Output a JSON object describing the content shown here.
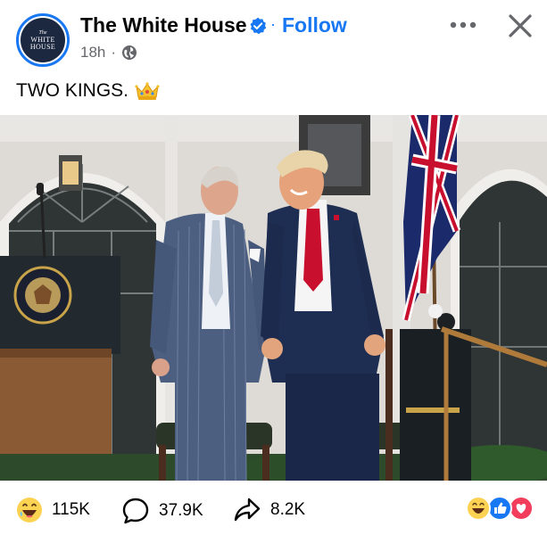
{
  "post": {
    "page_name": "The White House",
    "avatar_text_top": "The",
    "avatar_text_line1": "WHITE",
    "avatar_text_line2": "HOUSE",
    "separator": "·",
    "follow_label": "Follow",
    "time": "18h",
    "meta_dot": "·",
    "audience_icon": "globe-icon",
    "caption": "TWO KINGS.",
    "caption_emoji": "crown-emoji"
  },
  "engagement": {
    "reactions_count": "115K",
    "comments_count": "37.9K",
    "shares_count": "8.2K",
    "reaction_stack": [
      "laugh",
      "like",
      "love"
    ]
  },
  "colors": {
    "brand_blue": "#1877f2",
    "text_primary": "#050505",
    "text_secondary": "#65676b",
    "suit_navy": "#1e2d52",
    "tie_red": "#c8102e"
  }
}
